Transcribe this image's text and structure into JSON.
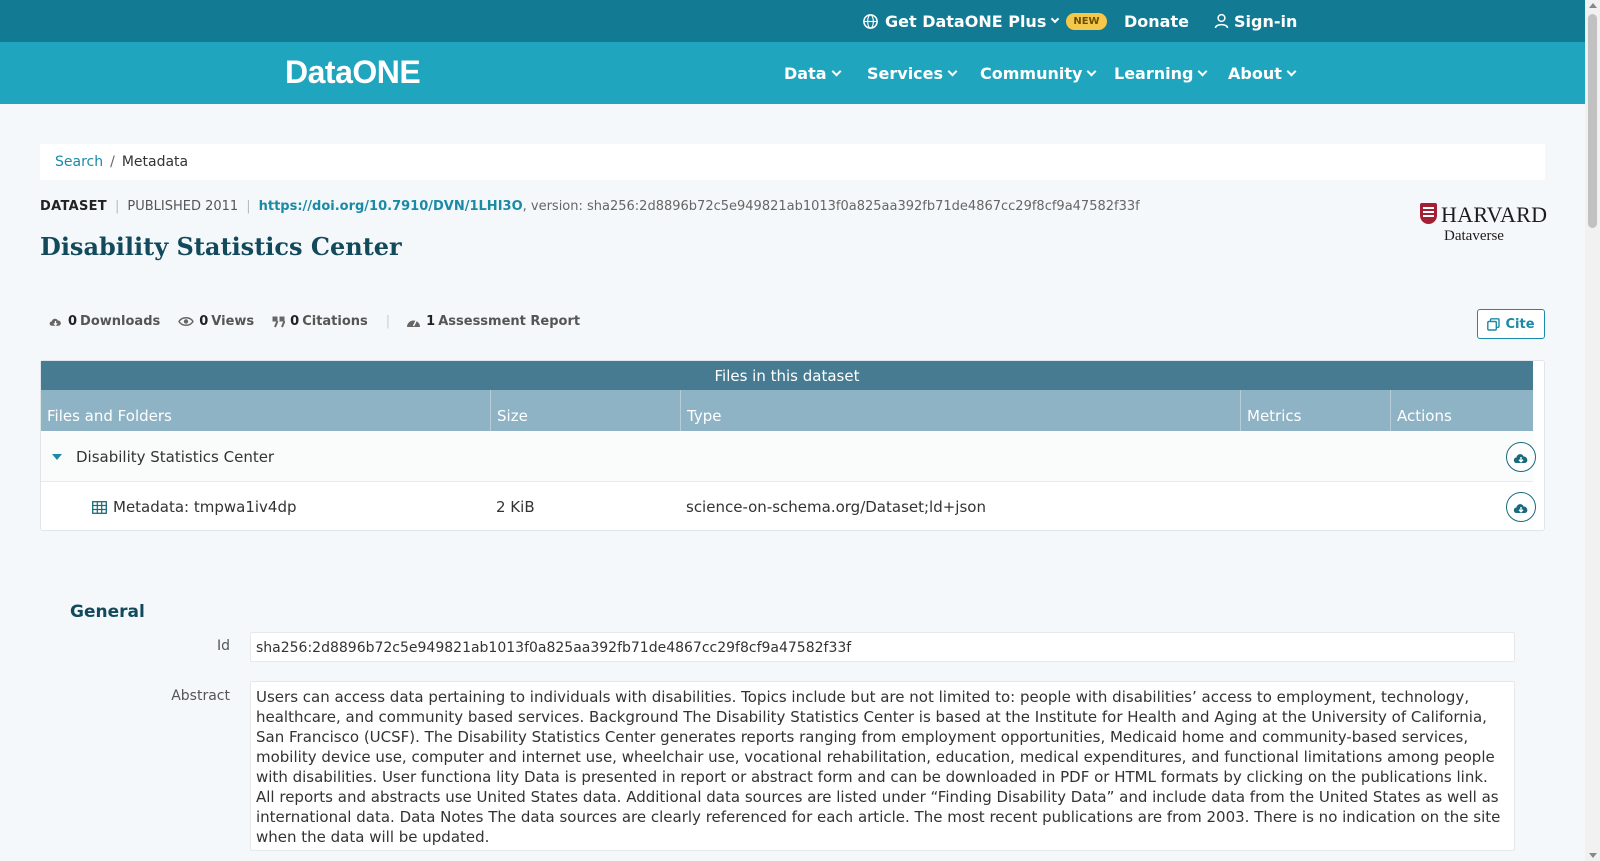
{
  "topbar": {
    "plus_label": "Get DataONE Plus",
    "new_badge": "NEW",
    "donate": "Donate",
    "signin": "Sign-in"
  },
  "brand": {
    "logo_text": "DataONE"
  },
  "nav": {
    "items": [
      {
        "label": "Data"
      },
      {
        "label": "Services"
      },
      {
        "label": "Community"
      },
      {
        "label": "Learning"
      },
      {
        "label": "About"
      }
    ]
  },
  "breadcrumb": {
    "search": "Search",
    "separator": "/",
    "current": "Metadata"
  },
  "dataset": {
    "type": "DATASET",
    "published": "PUBLISHED 2011",
    "doi": "https://doi.org/10.7910/DVN/1LHI3O",
    "version": ", version: sha256:2d8896b72c5e949821ab1013f0a825aa392fb71de4867cc29f8cf9a47582f33f",
    "title": "Disability Statistics Center"
  },
  "repository": {
    "line1": "HARVARD",
    "line2": "Dataverse"
  },
  "metrics": {
    "downloads_count": "0",
    "downloads_label": "Downloads",
    "views_count": "0",
    "views_label": "Views",
    "citations_count": "0",
    "citations_label": "Citations",
    "assessment_count": "1",
    "assessment_label": "Assessment Report"
  },
  "cite_label": "Cite",
  "files": {
    "caption": "Files in this dataset",
    "headers": [
      "Files and Folders",
      "Size",
      "Type",
      "Metrics",
      "Actions"
    ],
    "folder": {
      "name": "Disability Statistics Center"
    },
    "file": {
      "name": "Metadata: tmpwa1iv4dp",
      "size": "2 KiB",
      "type": "science-on-schema.org/Dataset;ld+json"
    }
  },
  "general": {
    "title": "General",
    "id_label": "Id",
    "id_value": "sha256:2d8896b72c5e949821ab1013f0a825aa392fb71de4867cc29f8cf9a47582f33f",
    "abstract_label": "Abstract",
    "abstract_value": "Users can access data pertaining to individuals with disabilities. Topics include but are not limited to: people with disabilities’ access to employment, technology, healthcare, and community based services. Background The Disability Statistics Center is based at the Institute for Health and Aging at the University of California, San Francisco (UCSF). The Disability Statistics Center generates reports ranging from employment opportunities, Medicaid home and community-based services, mobility device use, computer and internet use, wheelchair use, vocational rehabilitation, education, medical expenditures, and functional limitations among people with disabilities. User functiona lity Data is presented in report or abstract form and can be downloaded in PDF or HTML formats by clicking on the publications link. All reports and abstracts use United States data. Additional data sources are listed under “Finding Disability Data” and include data from the United States as well as international data. Data Notes The data sources are clearly referenced for each article. The most recent publications are from 2003. There is no indication on the site when the data will be updated."
  },
  "colors": {
    "topbar": "#127b93",
    "navbar": "#20a5be",
    "accent": "#1a8aa6",
    "title": "#124a5c",
    "table_caption": "#477b92",
    "table_header": "#8eb3c4",
    "badge": "#f5c84b"
  },
  "icons": [
    "globe-icon",
    "user-icon",
    "download-cloud-icon",
    "eye-icon",
    "quote-icon",
    "gauge-icon",
    "copy-icon",
    "table-icon",
    "caret-down-icon",
    "chevron-down-icon"
  ]
}
